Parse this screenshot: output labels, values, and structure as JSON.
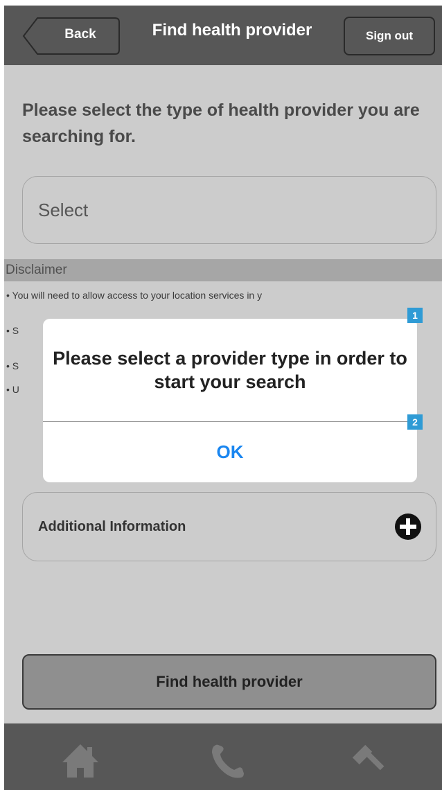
{
  "header": {
    "back_label": "Back",
    "title": "Find health provider",
    "signout_label": "Sign out"
  },
  "prompt": "Please select the type of health provider you are searching for.",
  "select": {
    "value": "Select"
  },
  "disclaimer": {
    "heading": "Disclaimer",
    "items": [
      "You will need to allow access to your location services in y",
      "S",
      "S",
      "U"
    ]
  },
  "additional_info": {
    "label": "Additional Information",
    "icon": "plus-circle-icon"
  },
  "find_button": "Find health provider",
  "dialog": {
    "message": "Please select a provider type in order to start your search",
    "ok_label": "OK"
  },
  "markers": [
    "1",
    "2"
  ],
  "bottom_nav": [
    {
      "icon": "home-icon"
    },
    {
      "icon": "phone-icon"
    },
    {
      "icon": "gavel-icon"
    }
  ],
  "colors": {
    "bar": "#575757",
    "background": "#cccccc",
    "ok_blue": "#1a86f0",
    "marker_blue": "#2f9bd5"
  }
}
